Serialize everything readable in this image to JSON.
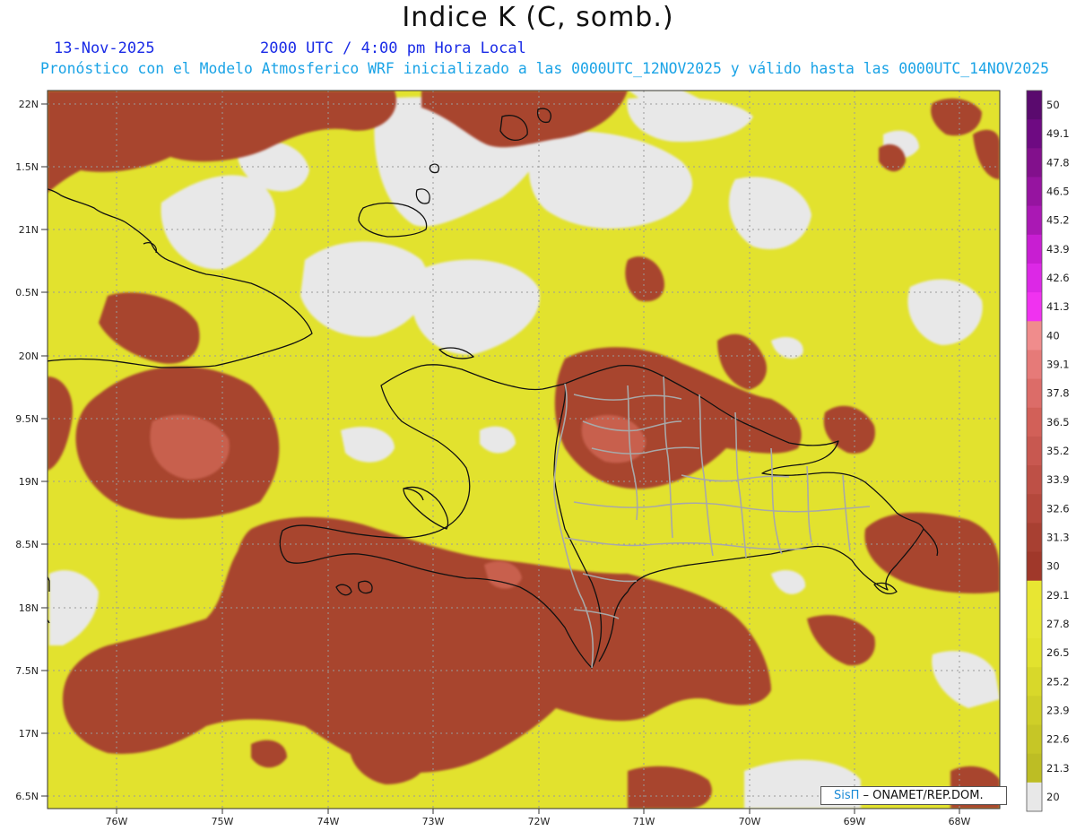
{
  "header": {
    "title": "Indice K (C, somb.)",
    "date": "13-Nov-2025",
    "time": "2000 UTC / 4:00 pm Hora Local",
    "forecast_line": "Pronóstico con el Modelo Atmosferico WRF inicializado a las 0000UTC_12NOV2025 y válido hasta las  0000UTC_14NOV2025"
  },
  "map": {
    "lat_labels": [
      "22N",
      "1.5N",
      "21N",
      "0.5N",
      "20N",
      "9.5N",
      "19N",
      "8.5N",
      "18N",
      "7.5N",
      "17N",
      "6.5N"
    ],
    "lon_labels": [
      "76W",
      "75W",
      "74W",
      "73W",
      "72W",
      "71W",
      "70W",
      "69W",
      "68W"
    ],
    "background_color": "#e8e8e8",
    "regions": [
      {
        "name": "Cuba (eastern)",
        "type": "land"
      },
      {
        "name": "Haiti",
        "type": "land"
      },
      {
        "name": "Dominican Republic",
        "type": "land"
      },
      {
        "name": "Jamaica",
        "type": "land"
      },
      {
        "name": "Great Inagua",
        "type": "land"
      }
    ]
  },
  "colorbar": {
    "labels": [
      "50",
      "49.1",
      "47.8",
      "46.5",
      "45.2",
      "43.9",
      "42.6",
      "41.3",
      "40",
      "39.1",
      "37.8",
      "36.5",
      "35.2",
      "33.9",
      "32.6",
      "31.3",
      "30",
      "29.1",
      "27.8",
      "26.5",
      "25.2",
      "23.9",
      "22.6",
      "21.3",
      "20"
    ],
    "colors": [
      "#5a0a6e",
      "#6e0a82",
      "#82108c",
      "#9614a0",
      "#aa18b4",
      "#c81ed2",
      "#dc28e6",
      "#f032f0",
      "#f08c8c",
      "#e67a78",
      "#dc6c68",
      "#d26058",
      "#c85850",
      "#be5046",
      "#b4483c",
      "#a84032",
      "#a0382a",
      "#e8e632",
      "#e6e634",
      "#e2e22e",
      "#d8d82a",
      "#cfcf28",
      "#c6c626",
      "#bdbd24",
      "#e8e8e8"
    ],
    "colors_note": "top-to-bottom"
  },
  "credit": {
    "sis": "SisΠ",
    "org": " – ONAMET/REP.DOM."
  }
}
